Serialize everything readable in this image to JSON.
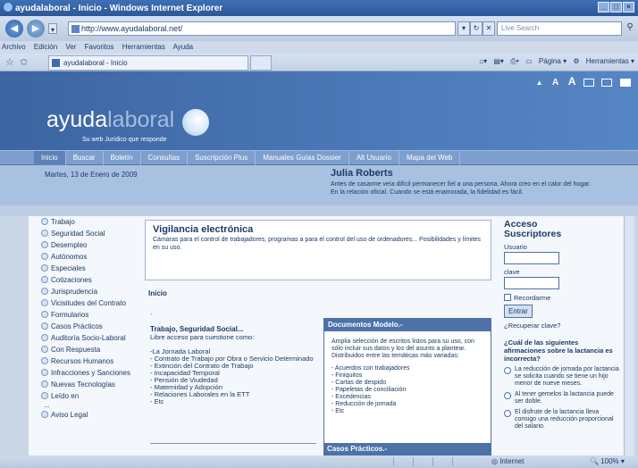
{
  "window": {
    "title": "ayudalaboral - Inicio - Windows Internet Explorer",
    "url": "http://www.ayudalaboral.net/",
    "search_placeholder": "Live Search",
    "tab_title": "ayudalaboral - Inicio"
  },
  "menu": [
    "Archivo",
    "Edición",
    "Ver",
    "Favoritos",
    "Herramientas",
    "Ayuda"
  ],
  "toolbar": {
    "pagina": "Página",
    "herramientas": "Herramientas"
  },
  "site": {
    "logo_main": "ayuda",
    "logo_accent": "laboral",
    "tagline": "Su web Jurídico que responde",
    "accessibility": [
      "A",
      "A"
    ],
    "nav": [
      "Inicio",
      "Buscar",
      "Boletín",
      "Consultas",
      "Suscripción Plus",
      "Manuales Guías Dossier",
      "Alt Usuario",
      "Mapa del Web"
    ],
    "date": "Martes, 13 de Enero de 2009",
    "quote_author": "Julia Roberts",
    "quote_text": "Antes de casarme veía difícil permanecer fiel a una persona. Ahora creo en el calor del hogar. En la relación oficial. Cuando se está enamorada, la fidelidad es fácil."
  },
  "sidebar": {
    "items": [
      "Trabajo",
      "Seguridad Social",
      "Desempleo",
      "Autónomos",
      "Especiales",
      "Cotizaciones",
      "Jurisprudencia",
      "Vicisitudes del Contrato",
      "Formularios",
      "Casos Prácticos",
      "Auditoría Socio-Laboral",
      "Con Respuesta",
      "Recursos Humanos",
      "Infracciones y Sanciones",
      "Nuevas Tecnologías",
      "Leído en"
    ],
    "ellipsis": "...",
    "legal": "Aviso Legal"
  },
  "vigilancia": {
    "title": "Vigilancia electrónica",
    "text": "Cámaras para el control de trabajadores, programas a para el control del uso de ordenadores... Posibilidades y límites en su uso."
  },
  "breadcrumb": "Inicio",
  "breadcrumb_dot": ".",
  "trabajo": {
    "title": "Trabajo, Seguridad Social...",
    "subtitle": "Libre acceso para cuestione como:",
    "items": [
      "-La Jornada Laboral",
      "- Contrato de Trabajo por Obra o Servicio Determinado",
      "- Extinción del Contrato de Trabajo",
      "- Incapacidad Temporal",
      "- Pensión de Viudedad",
      "- Maternidad y Adopción",
      "- Relaciones Laborales en la ETT",
      "- Etc"
    ]
  },
  "documentos": {
    "title": "Documentos Modelo.-",
    "intro": "Amplia selección de escritos listos para su uso, con sólo incluir sus datos y los del asunto a plantear. Distribuidos entre las temáticas más variadas:",
    "items": [
      "- Acuerdos con trabajadores",
      "- Finiquitos",
      "- Cartas de despido",
      "- Papeletas de conciliación",
      "- Excedencias",
      "- Reducción de jornada",
      "- Etc"
    ]
  },
  "casos": {
    "title": "Casos Prácticos.-"
  },
  "login": {
    "title_line1": "Acceso",
    "title_line2": "Suscriptores",
    "user_label": "Usuario",
    "pass_label": "clave",
    "remember": "Recordarme",
    "submit": "Entrar",
    "recover": "¿Recuperar clave?"
  },
  "poll": {
    "question": "¿Cuál de las siguientes afirmaciones sobre la lactancia es incorrecta?",
    "options": [
      "La reducción de jornada por lactancia se solicita cuando se tiene un hijo menor de nueve meses.",
      "Al tener gemelos la lactancia puede ser doble.",
      "El disfrute de la lactancia lleva consigo una reducción proporcional del salario."
    ]
  },
  "status": {
    "zone": "Internet",
    "zoom": "100%"
  },
  "colors": {
    "banner": "#4c79b8",
    "nav": "#7d9fcd",
    "text": "#1b3a66"
  }
}
